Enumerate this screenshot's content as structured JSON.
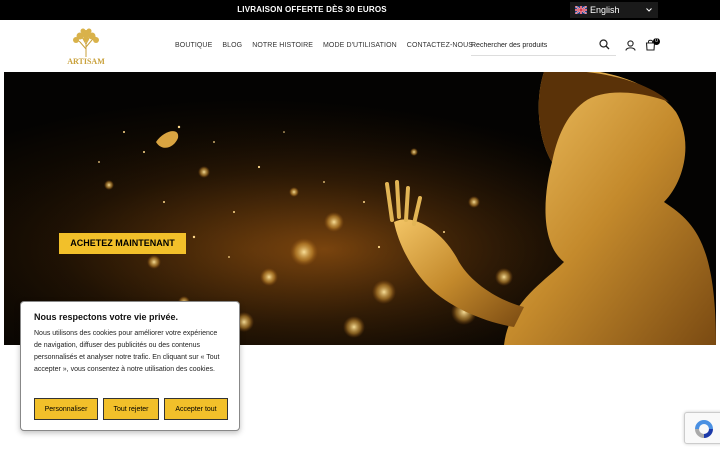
{
  "topbar": {
    "promo": "LIVRAISON OFFERTE DÈS 30 EUROS",
    "language": "English"
  },
  "header": {
    "logo_text": "ARTISAM",
    "nav": [
      "BOUTIQUE",
      "BLOG",
      "NOTRE HISTOIRE",
      "MODE D'UTILISATION",
      "CONTACTEZ-NOUS"
    ],
    "search_placeholder": "Rechercher des produits",
    "cart_count": "0"
  },
  "hero": {
    "cta": "ACHETEZ MAINTENANT"
  },
  "cookie": {
    "title": "Nous respectons votre vie privée.",
    "text": "Nous utilisons des cookies pour améliorer votre expérience de navigation, diffuser des publicités ou des contenus personnalisés et analyser notre trafic. En cliquant sur « Tout accepter », vous consentez à notre utilisation des cookies.",
    "buttons": [
      "Personnaliser",
      "Tout rejeter",
      "Accepter tout"
    ]
  },
  "colors": {
    "accent": "#f2c02a",
    "topbar": "#000000"
  },
  "icons": [
    "uk-flag-icon",
    "chevron-down-icon",
    "search-icon",
    "user-icon",
    "cart-icon",
    "recaptcha-icon"
  ]
}
